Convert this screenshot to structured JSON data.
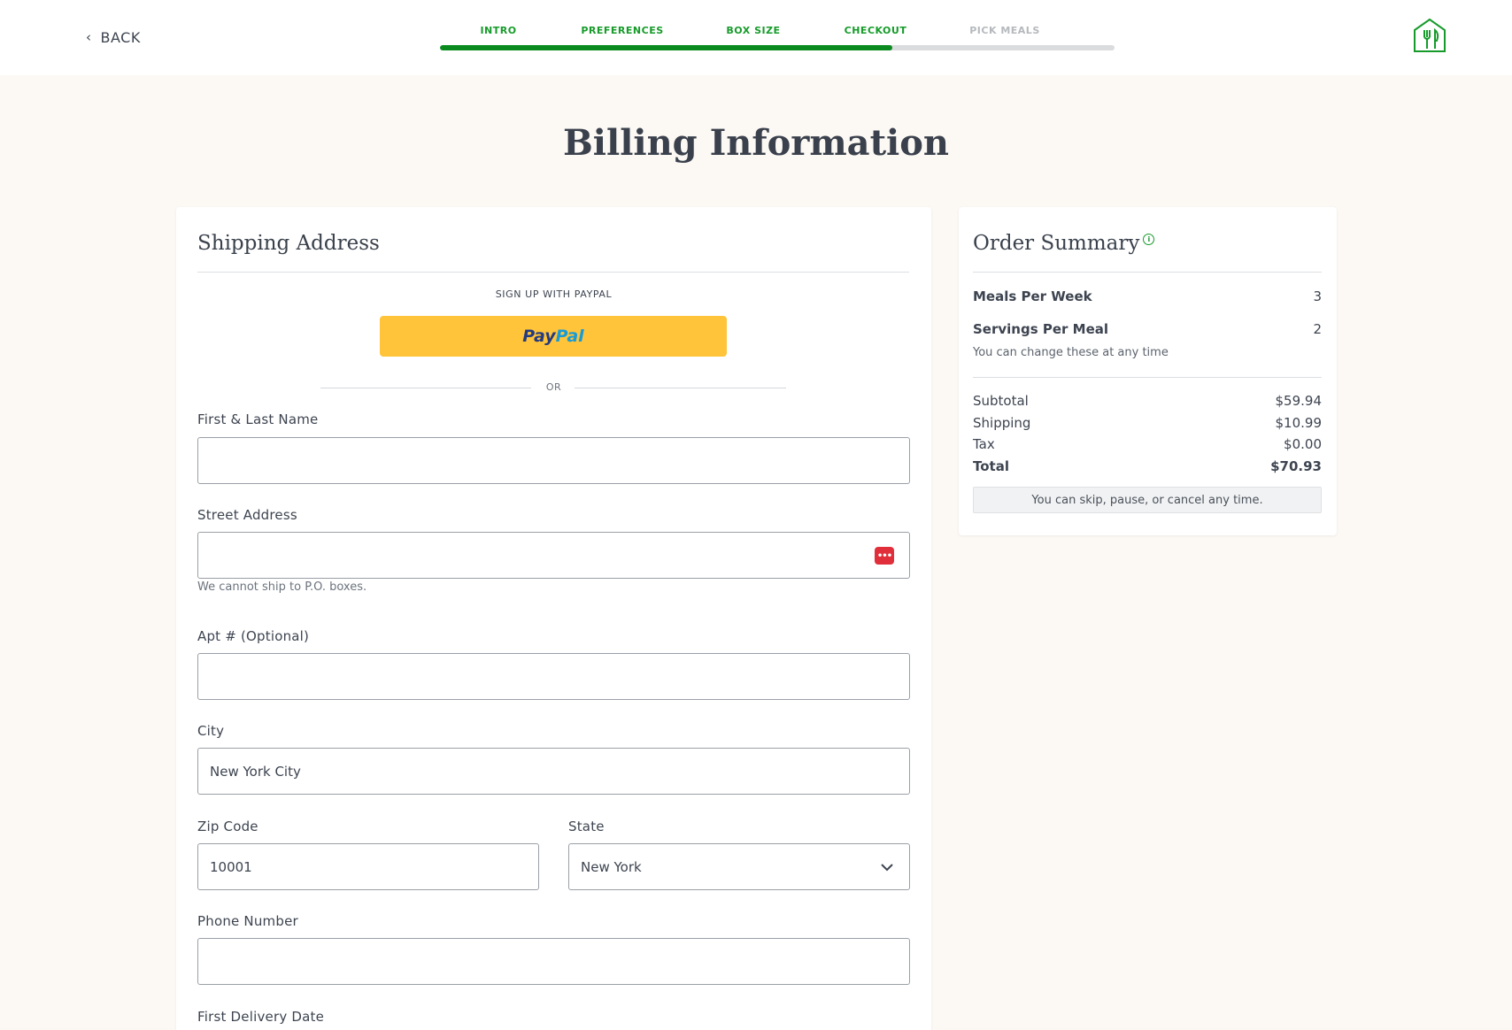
{
  "header": {
    "back_label": "BACK",
    "steps": [
      {
        "label": "INTRO",
        "status": "done"
      },
      {
        "label": "PREFERENCES",
        "status": "done"
      },
      {
        "label": "BOX SIZE",
        "status": "done"
      },
      {
        "label": "CHECKOUT",
        "status": "done"
      },
      {
        "label": "PICK MEALS",
        "status": "todo"
      }
    ],
    "progress_fraction": 0.67,
    "logo_icon": "home-chef-house-fork-knife-icon"
  },
  "page_title": "Billing Information",
  "shipping": {
    "title": "Shipping Address",
    "paypal_caption": "SIGN UP WITH PAYPAL",
    "paypal_button_pay": "Pay",
    "paypal_button_pal": "Pal",
    "or_text": "OR",
    "name_label": "First & Last Name",
    "name_value": "",
    "street_label": "Street Address",
    "street_value": "",
    "street_hint": "We cannot ship to P.O. boxes.",
    "password_manager_icon": "password-manager-icon",
    "apt_label": "Apt # (Optional)",
    "apt_value": "",
    "city_label": "City",
    "city_value": "New York City",
    "zip_label": "Zip Code",
    "zip_value": "10001",
    "state_label": "State",
    "state_value": "New York",
    "phone_label": "Phone Number",
    "phone_value": "",
    "delivery_label": "First Delivery Date"
  },
  "summary": {
    "title": "Order Summary",
    "meals_label": "Meals Per Week",
    "meals_value": "3",
    "servings_label": "Servings Per Meal",
    "servings_value": "2",
    "change_note": "You can change these at any time",
    "subtotal_label": "Subtotal",
    "subtotal_value": "$59.94",
    "shipping_label": "Shipping",
    "shipping_value": "$10.99",
    "tax_label": "Tax",
    "tax_value": "$0.00",
    "total_label": "Total",
    "total_value": "$70.93",
    "cancel_note": "You can skip, pause, or cancel any time."
  },
  "colors": {
    "brand_green": "#169b2a",
    "progress_green": "#0b8a1f",
    "paypal_yellow": "#ffc439",
    "background": "#fcf8f4"
  }
}
